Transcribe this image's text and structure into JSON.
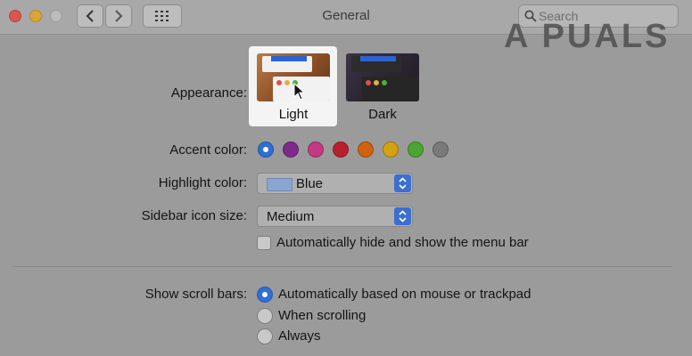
{
  "window": {
    "title": "General"
  },
  "search": {
    "placeholder": "Search"
  },
  "watermark": "A PUALS",
  "appearance": {
    "label": "Appearance:",
    "options": [
      {
        "label": "Light",
        "selected": true
      },
      {
        "label": "Dark",
        "selected": false
      }
    ]
  },
  "accent": {
    "label": "Accent color:",
    "colors": [
      "#2f6fd6",
      "#7d2a8c",
      "#c23a82",
      "#b8202f",
      "#d0620f",
      "#d4a113",
      "#4aa533",
      "#7a7a7a"
    ],
    "selected_index": 0
  },
  "highlight": {
    "label": "Highlight color:",
    "value": "Blue",
    "swatch_color": "#8aa6cf"
  },
  "sidebar_icon_size": {
    "label": "Sidebar icon size:",
    "value": "Medium"
  },
  "menubar": {
    "label": "Automatically hide and show the menu bar",
    "checked": false
  },
  "scroll_bars": {
    "label": "Show scroll bars:",
    "options": [
      {
        "label": "Automatically based on mouse or trackpad",
        "selected": true
      },
      {
        "label": "When scrolling",
        "selected": false
      },
      {
        "label": "Always",
        "selected": false
      }
    ]
  }
}
